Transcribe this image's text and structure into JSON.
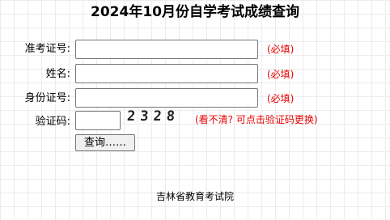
{
  "page": {
    "title": "2024年10月份自学考试成绩查询"
  },
  "form": {
    "exam_id": {
      "label": "准考证号:",
      "value": "",
      "hint": "(必填)"
    },
    "name": {
      "label": "姓名:",
      "value": "",
      "hint": "(必填)"
    },
    "id_card": {
      "label": "身份证号:",
      "value": "",
      "hint": "(必填)"
    },
    "captcha": {
      "label": "验证码:",
      "value": "",
      "image_text": "2328",
      "hint": "(看不清? 可点击验证码更换)"
    },
    "submit_label": "查询……"
  },
  "footer": {
    "org": "吉林省教育考试院"
  },
  "colors": {
    "hint_red": "#e60000",
    "grid_line": "#ececec"
  }
}
